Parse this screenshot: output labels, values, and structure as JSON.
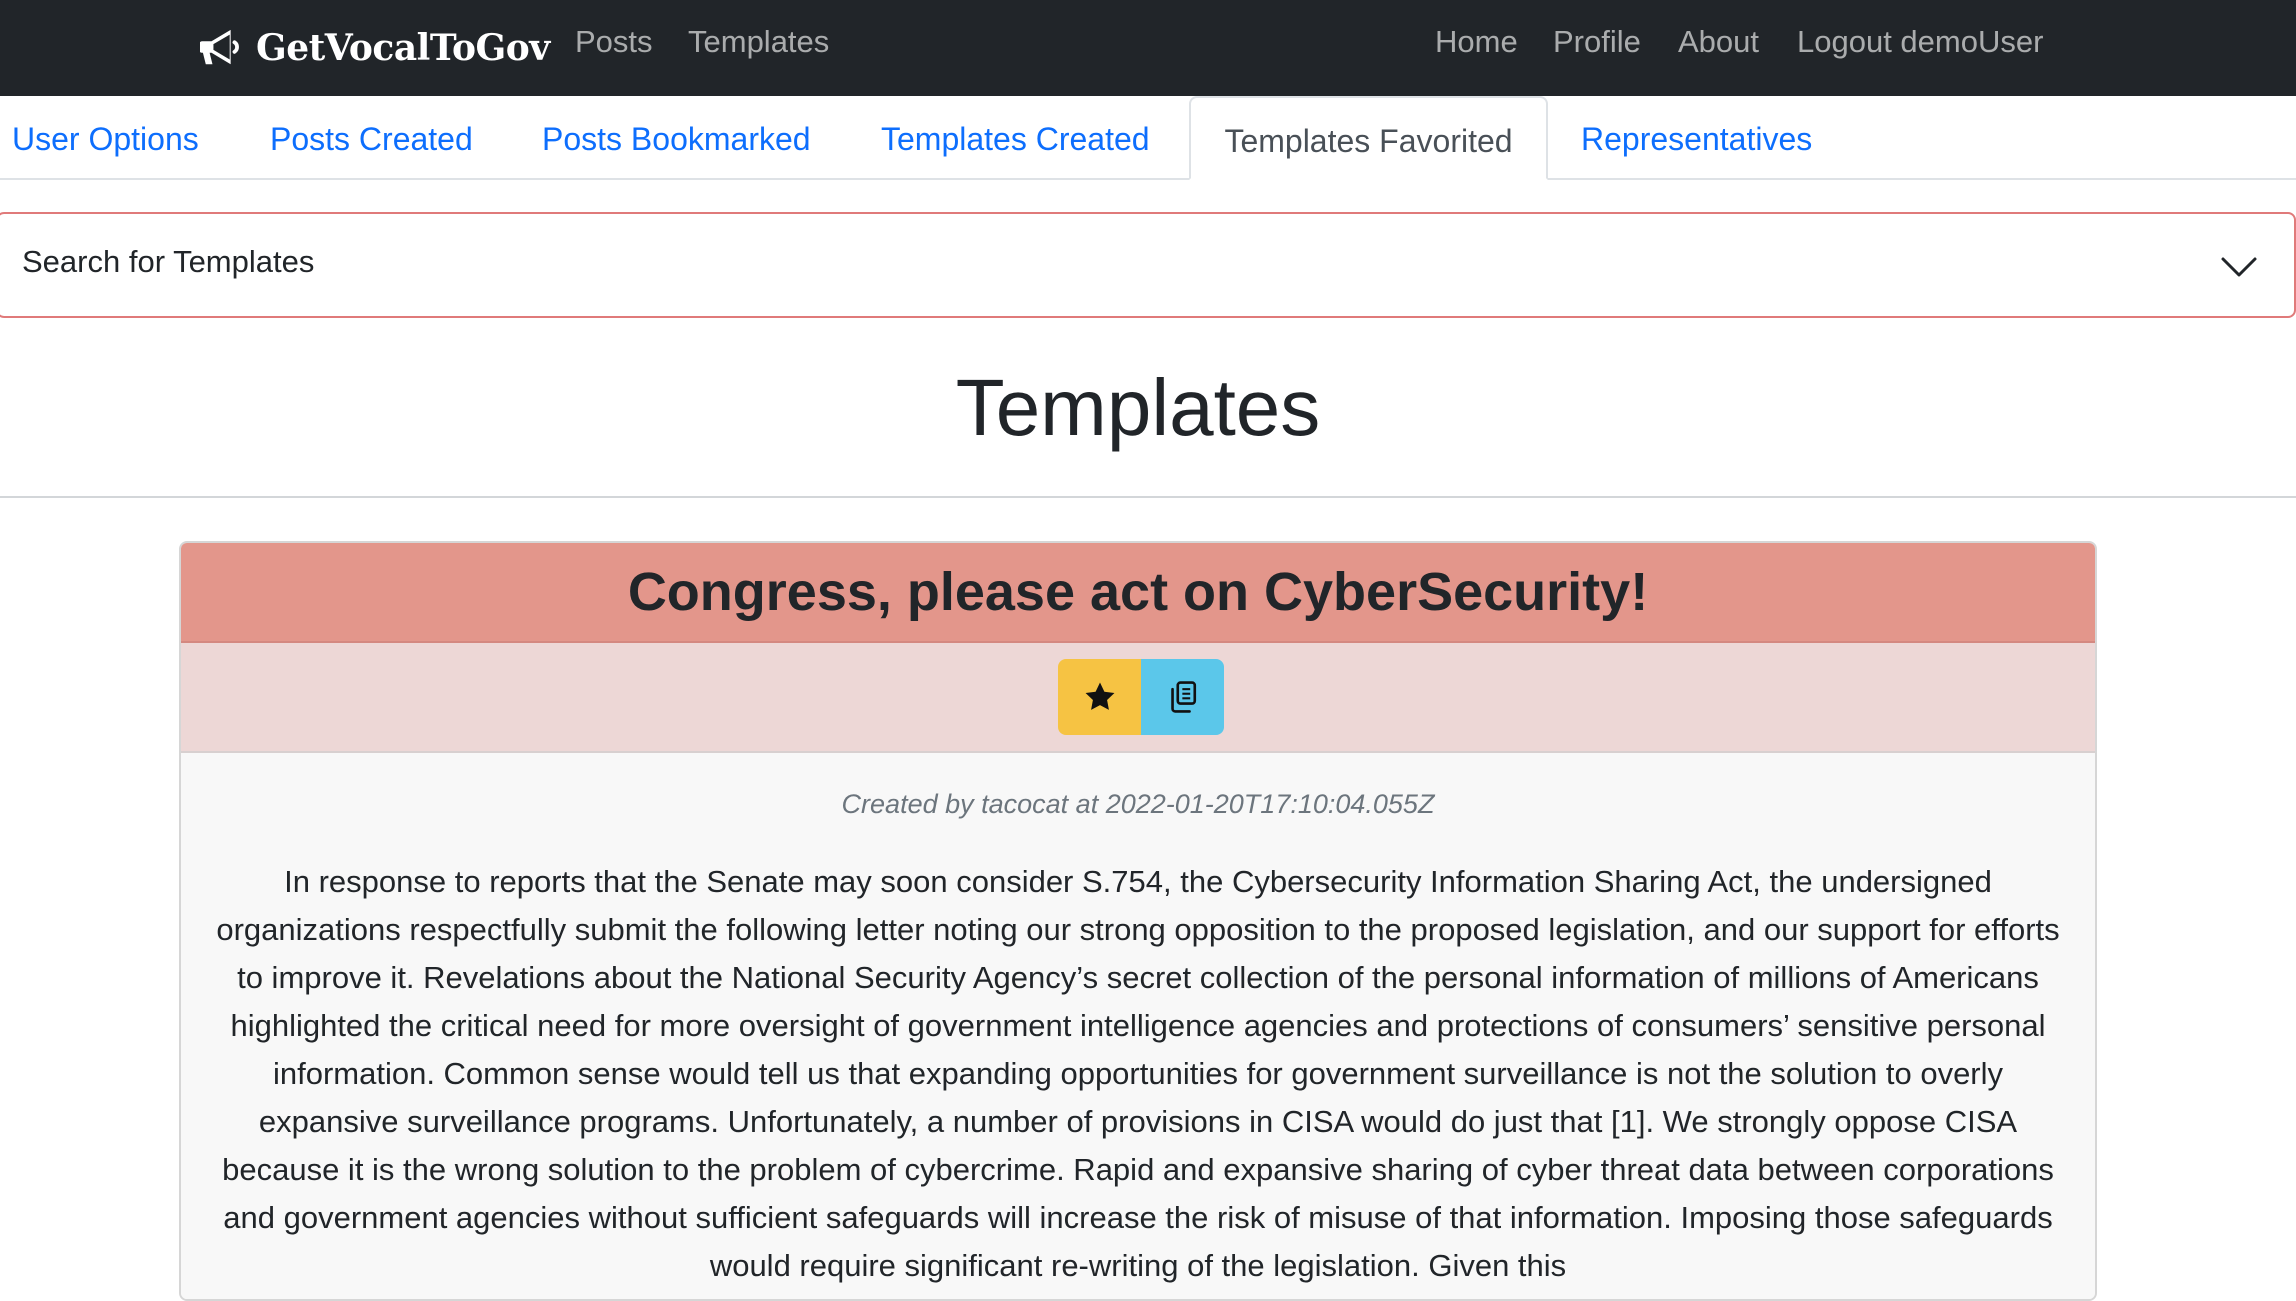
{
  "navbar": {
    "brand": "GetVocalToGov",
    "brand_icon": "megaphone-icon",
    "left_links": [
      "Posts",
      "Templates"
    ],
    "right_links": [
      "Home",
      "Profile",
      "About",
      "Logout demoUser"
    ]
  },
  "tabs": {
    "items": [
      "User Options",
      "Posts Created",
      "Posts Bookmarked",
      "Templates Created",
      "Templates Favorited",
      "Representatives"
    ],
    "active": "Templates Favorited"
  },
  "search": {
    "label": "Search for Templates",
    "toggle_icon": "chevron-down-icon"
  },
  "page": {
    "title": "Templates"
  },
  "template": {
    "title": "Congress, please act on CyberSecurity!",
    "favorite_icon": "star-icon",
    "copy_icon": "copy-icon",
    "byline": "Created by tacocat at 2022-01-20T17:10:04.055Z",
    "body": "In response to reports that the Senate may soon consider S.754, the Cybersecurity Information Sharing Act, the undersigned organizations respectfully submit the following letter noting our strong opposition to the proposed legislation, and our support for efforts to improve it. Revelations about the National Security Agency’s secret collection of the personal information of millions of Americans highlighted the critical need for more oversight of government intelligence agencies and protections of consumers’ sensitive personal information. Common sense would tell us that expanding opportunities for government surveillance is not the solution to overly expansive surveillance programs. Unfortunately, a number of provisions in CISA would do just that [1]. We strongly oppose CISA because it is the wrong solution to the problem of cybercrime. Rapid and expansive sharing of cyber threat data between corporations and government agencies without sufficient safeguards will increase the risk of misuse of that information. Imposing those safeguards would require significant re-writing of the legislation. Given this"
  },
  "colors": {
    "navbar_bg": "#212529",
    "link_blue": "#0d6efd",
    "card_header": "#e3968b",
    "card_actions": "#edd7d6",
    "favorite_button": "#f6c343",
    "copy_button": "#5bc7ea"
  }
}
